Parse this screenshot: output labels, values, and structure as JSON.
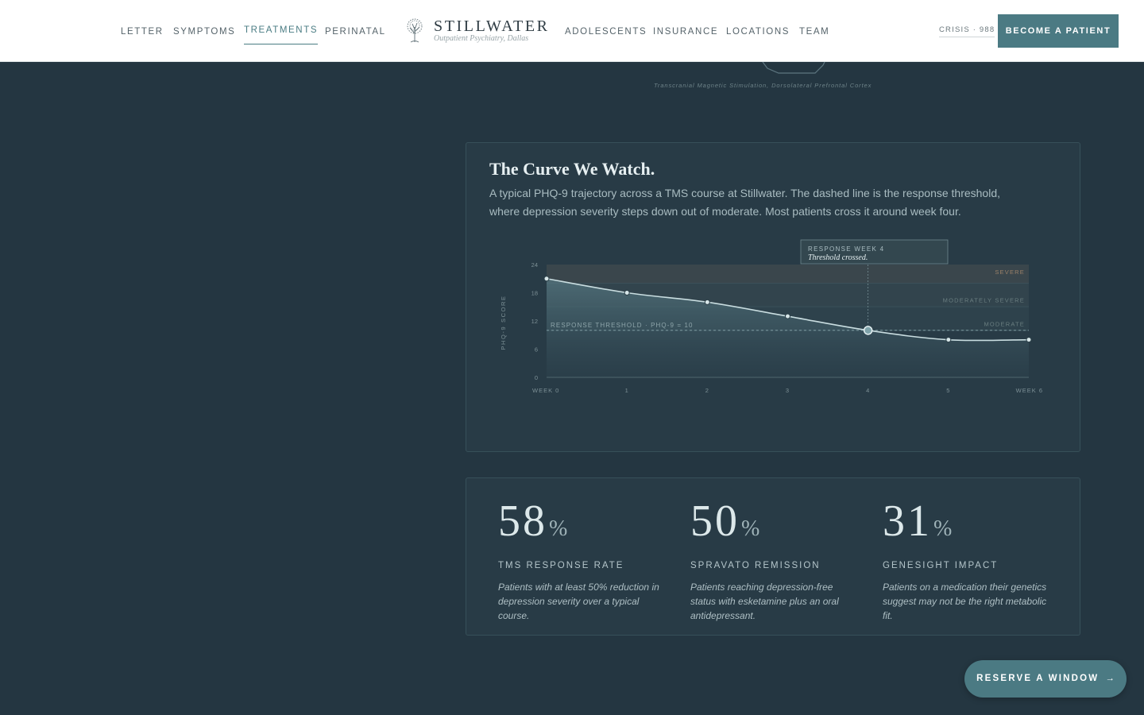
{
  "header": {
    "nav_left": [
      {
        "label": "LETTER",
        "active": false
      },
      {
        "label": "SYMPTOMS",
        "active": false
      },
      {
        "label": "TREATMENTS",
        "active": true
      },
      {
        "label": "PERINATAL",
        "active": false
      }
    ],
    "brand": {
      "name": "STILLWATER",
      "tagline": "Outpatient Psychiatry, Dallas",
      "icon": "tree-icon"
    },
    "nav_right": [
      {
        "label": "ADOLESCENTS"
      },
      {
        "label": "INSURANCE"
      },
      {
        "label": "LOCATIONS"
      },
      {
        "label": "TEAM"
      }
    ],
    "crisis_label": "CRISIS · 988",
    "cta_label": "BECOME A PATIENT"
  },
  "diagram_caption": "Transcranial Magnetic Stimulation, Dorsolateral Prefrontal Cortex",
  "curve_card": {
    "title": "The Curve We Watch.",
    "description": "A typical PHQ-9 trajectory across a TMS course at Stillwater. The dashed line is the response threshold, where depression severity steps down out of moderate. Most patients cross it around week four."
  },
  "chart_data": {
    "type": "area",
    "title": "",
    "xlabel": "",
    "ylabel": "PHQ-9 SCORE",
    "ylim": [
      0,
      24
    ],
    "y_ticks": [
      0,
      6,
      12,
      18,
      24
    ],
    "categories": [
      "WEEK 0",
      "1",
      "2",
      "3",
      "4",
      "5",
      "WEEK 6"
    ],
    "x": [
      0,
      1,
      2,
      3,
      4,
      5,
      6
    ],
    "values": [
      21,
      18,
      16,
      13,
      10,
      8,
      8
    ],
    "grid": false,
    "bands": [
      {
        "label": "SEVERE",
        "from": 20,
        "to": 24
      },
      {
        "label": "MODERATELY SEVERE",
        "from": 15,
        "to": 20
      },
      {
        "label": "MODERATE",
        "from": 10,
        "to": 15
      }
    ],
    "threshold": {
      "value": 10,
      "label": "RESPONSE THRESHOLD · PHQ-9 = 10"
    },
    "annotation": {
      "x": 4,
      "title": "RESPONSE WEEK 4",
      "text": "Threshold crossed."
    },
    "colors": {
      "line": "#c9dde0",
      "fill": "#4d6e76",
      "severe_label": "#9a8068",
      "band_label": "#6a7e80"
    }
  },
  "stats": [
    {
      "value": "58",
      "unit": "%",
      "label": "TMS RESPONSE RATE",
      "desc": "Patients with at least 50% reduction in depression severity over a typical course."
    },
    {
      "value": "50",
      "unit": "%",
      "label": "SPRAVATO REMISSION",
      "desc": "Patients reaching depression-free status with esketamine plus an oral antidepressant."
    },
    {
      "value": "31",
      "unit": "%",
      "label": "GENESIGHT IMPACT",
      "desc": "Patients on a medication their genetics suggest may not be the right metabolic fit."
    }
  ],
  "reserve_button": {
    "label": "RESERVE A WINDOW",
    "arrow": "→"
  }
}
